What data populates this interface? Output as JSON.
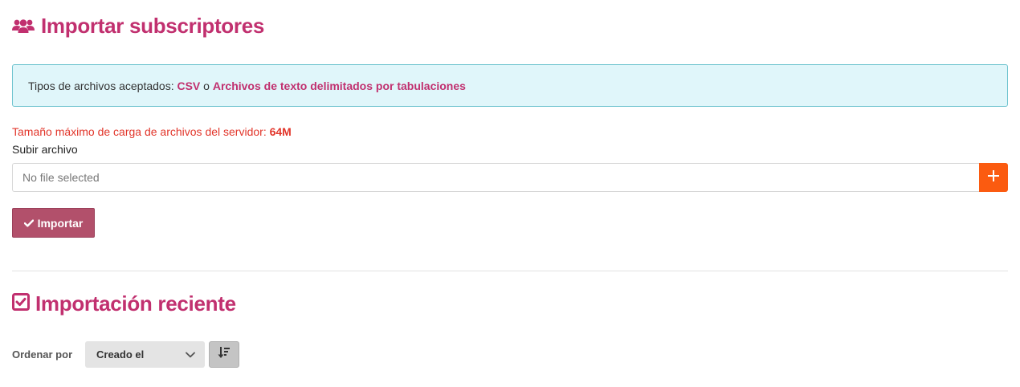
{
  "header": {
    "title": "Importar subscriptores",
    "icon": "users-icon"
  },
  "info": {
    "prefix": "Tipos de archivos aceptados: ",
    "csv_link": "CSV",
    "separator": " o ",
    "tsv_link": "Archivos de texto delimitados por tabulaciones"
  },
  "limit": {
    "text": "Tamaño máximo de carga de archivos del servidor: ",
    "value": "64M"
  },
  "upload": {
    "label": "Subir archivo",
    "file_status": "No file selected",
    "add_icon": "plus-icon"
  },
  "import_button": {
    "label": "Importar",
    "icon": "check-icon"
  },
  "recent": {
    "title": "Importación reciente",
    "icon": "checkbox-icon"
  },
  "sort": {
    "label": "Ordenar por",
    "selected": "Creado el",
    "direction_icon": "sort-descending-icon"
  },
  "colors": {
    "accent": "#c1306f",
    "info_bg": "#e0f6fa",
    "info_border": "#6fc4cf",
    "warning": "#e2362b",
    "orange": "#fb5b10",
    "button": "#b2506b"
  }
}
